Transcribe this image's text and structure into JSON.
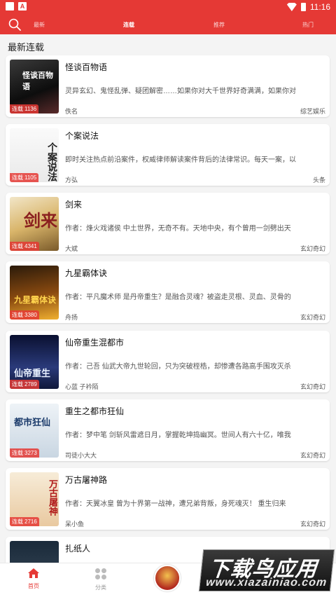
{
  "status_bar": {
    "time": "11:16",
    "badge": "A"
  },
  "top_tabs": [
    {
      "label": "最新"
    },
    {
      "label": "连载"
    },
    {
      "label": "推荐"
    },
    {
      "label": "热门"
    }
  ],
  "section_title": "最新连载",
  "chip_label": "连载",
  "books": [
    {
      "title": "怪谈百物语",
      "count": "1136",
      "desc": "灵异玄幻、鬼怪乱弹、疑团解密……如果你对大千世界好奇满满，如果你对",
      "author": "佚名",
      "category": "综艺娱乐",
      "cover_text": "怪谈百物语"
    },
    {
      "title": "个案说法",
      "count": "1105",
      "desc": "即时关注热点前沿案件，权威律师解读案件背后的法律常识。每天一案，以",
      "author": "方弘",
      "category": "头条",
      "cover_text": "个案说法"
    },
    {
      "title": "剑来",
      "count": "4341",
      "desc": "作者：烽火戏诸侯 中土世界，无奇不有。天地中央，有个曾用一剑劈出天",
      "author": "大斌",
      "category": "玄幻奇幻",
      "cover_text": "剑来"
    },
    {
      "title": "九星霸体诀",
      "count": "3380",
      "desc": "作者：平凡魔术师 是丹帝重生？是融合灵魂？被盗走灵根、灵血、灵骨的",
      "author": "舟扬",
      "category": "玄幻奇幻",
      "cover_text": "九星霸体诀"
    },
    {
      "title": "仙帝重生混都市",
      "count": "2789",
      "desc": "作者：己吾 仙武大帝九世轮回，只为突破桎梏，却惨遭各路高手围攻灭杀",
      "author": "心蓝 子衿陌",
      "category": "玄幻奇幻",
      "cover_text": "仙帝重生"
    },
    {
      "title": "重生之都市狂仙",
      "count": "3273",
      "desc": "作者：梦中笔 剑斩风雷遮日月，掌握乾坤捣幽冥。世间人有六十亿，唯我",
      "author": "司徒小大大",
      "category": "玄幻奇幻",
      "cover_text": "都市狂仙"
    },
    {
      "title": "万古屠神路",
      "count": "2716",
      "desc": "作者：天翼冰皇 曾为十界第一战神，遭兄弟背叛，身死魂灭！ 重生归来",
      "author": "呆小鱼",
      "category": "玄幻奇幻",
      "cover_text": "万古屠神"
    },
    {
      "title": "扎纸人",
      "count": "",
      "desc": "",
      "author": "",
      "category": "",
      "cover_text": ""
    }
  ],
  "bottom_nav": [
    {
      "label": "首页",
      "icon": "home-icon"
    },
    {
      "label": "分类",
      "icon": "grid-icon"
    }
  ],
  "watermark": {
    "line1": "下载鸟应用",
    "line2": "www.xiazainiao.com"
  },
  "colors": {
    "accent": "#e53935"
  }
}
